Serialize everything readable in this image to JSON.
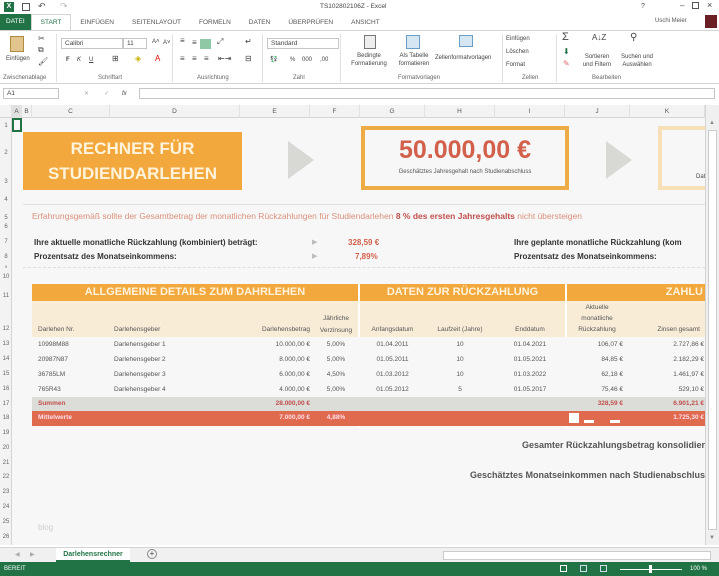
{
  "window": {
    "title": "TS102802106Z - Excel",
    "help": "?",
    "user": "Uschi Meier"
  },
  "tabs": [
    "DATEI",
    "START",
    "EINFÜGEN",
    "SEITENLAYOUT",
    "FORMELN",
    "DATEN",
    "ÜBERPRÜFEN",
    "ANSICHT"
  ],
  "ribbon": {
    "paste": "Einfügen",
    "font_name": "Calibri",
    "font_size": "11",
    "number_format": "Standard",
    "bold": "F",
    "italic": "K",
    "underline": "U",
    "conditional": "Bedingte Formatierung",
    "as_table": "Als Tabelle formatieren",
    "cell_styles": "Zellenformatvorlagen",
    "insert": "Einfügen",
    "delete": "Löschen",
    "format": "Format",
    "sort": "Sortieren und Filtern",
    "find": "Suchen und Auswählen",
    "groups": [
      "Zwischenablage",
      "Schriftart",
      "Ausrichtung",
      "Zahl",
      "Formatvorlagen",
      "Zellen",
      "Bearbeiten"
    ]
  },
  "formula_bar": {
    "name_box": "A1",
    "fx": "fx",
    "value": ""
  },
  "columns": [
    "A",
    "B",
    "C",
    "D",
    "E",
    "F",
    "G",
    "H",
    "I",
    "J",
    "K"
  ],
  "rows": [
    "1",
    "2",
    "3",
    "4",
    "5",
    "6",
    "7",
    "8",
    "9",
    "10",
    "11",
    "12",
    "13",
    "14",
    "15",
    "16",
    "17",
    "18",
    "19",
    "20",
    "21",
    "22",
    "23",
    "24",
    "25",
    "26"
  ],
  "sheet": {
    "title_line1": "RECHNER FÜR",
    "title_line2": "STUDIENDARLEHEN",
    "salary_value": "50.000,00 €",
    "salary_label": "Geschätztes Jahresgehalt nach Studienabschluss",
    "cut_box_label": "Dat",
    "note_pre": "Erfahrungsgemäß sollte der Gesamtbetrag der monatlichen Rückzahlungen für Studiendarlehen ",
    "note_bold": "8 % des ersten Jahresgehalts",
    "note_post": " nicht übersteigen",
    "current_label": "Ihre aktuelle monatliche Rückzahlung (kombiniert) beträgt:",
    "current_value": "328,59 €",
    "percent_label": "Prozentsatz des Monatseinkommens:",
    "percent_value": "7,89%",
    "planned_label": "Ihre geplante monatliche Rückzahlung (kom",
    "planned_percent_label": "Prozentsatz des Monatseinkommens:",
    "section1": "ALLGEMEINE DETAILS ZUM DAHRLEHEN",
    "section2": "DATEN ZUR RÜCKZAHLUNG",
    "section3": "ZAHLU",
    "headers": [
      "Darlehen Nr.",
      "Darlehensgeber",
      "Darlehensbetrag",
      "Jährliche Verzinsung",
      "Anfangsdatum",
      "Laufzeit (Jahre)",
      "Enddatum",
      "Aktuelle monatliche Rückzahlung",
      "Zinsen gesamt"
    ],
    "loans": [
      [
        "10998M88",
        "Darlehensgeber 1",
        "10.000,00 €",
        "5,00%",
        "01.04.2011",
        "10",
        "01.04.2021",
        "106,07 €",
        "2.727,86 €"
      ],
      [
        "20987N87",
        "Darlehensgeber 2",
        "8.000,00 €",
        "5,00%",
        "01.05.2011",
        "10",
        "01.05.2021",
        "84,85 €",
        "2.182,29 €"
      ],
      [
        "36785LM",
        "Darlehensgeber 3",
        "6.000,00 €",
        "4,50%",
        "01.03.2012",
        "10",
        "01.03.2022",
        "62,18 €",
        "1.461,97 €"
      ],
      [
        "765R43",
        "Darlehensgeber 4",
        "4.000,00 €",
        "5,00%",
        "01.05.2012",
        "5",
        "01.05.2017",
        "75,46 €",
        "529,10 €"
      ]
    ],
    "sum_label": "Summen",
    "sum_amount": "28.000,00 €",
    "sum_monthly": "328,59 €",
    "sum_interest": "6.901,21 €",
    "avg_label": "Mittelwerte",
    "avg_amount": "7.000,00 €",
    "avg_rate": "4,88%",
    "avg_interest": "1.725,30 €",
    "total_label": "Gesamter Rückzahlungsbetrag konsolidier",
    "income_label": "Geschätztes Monatseinkommen nach Studienabschlus",
    "watermark": "blog"
  },
  "sheet_tab": "Darlehensrechner",
  "status": {
    "ready": "BEREIT",
    "zoom": "100 %"
  },
  "colors": {
    "green": "#217346",
    "orange": "#f2a83c",
    "red": "#e06a4e",
    "text_red": "#c0504d"
  }
}
